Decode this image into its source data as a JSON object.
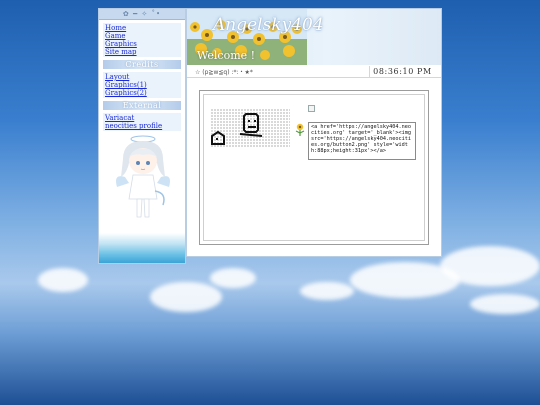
{
  "sidebar": {
    "top_label": "✿ ━ ✧ ˚•",
    "nav_links": [
      "Home",
      "Game",
      "Graphics",
      "Site map"
    ],
    "credits_heading": "Credits",
    "credit_links": [
      "Layout",
      "Graphics(1)",
      "Graphics(2)"
    ],
    "external_heading": "External",
    "external_links": [
      "Variacat",
      "neocities profile"
    ]
  },
  "banner": {
    "title": "Angelsky404",
    "welcome": "Welcome !"
  },
  "infobar": {
    "kaomoji": "☆ (p≧w≦q) :*:・★*",
    "clock": "08:36:10 PM"
  },
  "content": {
    "button_code": "<a href='https://angelsky404.neocities.org' target='_blank'><img src='https://angelsky404.neocities.org/button2.png' style='width:88px;height:31px'></a>"
  },
  "colors": {
    "link": "#1a2bd6",
    "sidebar_heading": "#b4ccea",
    "banner_sky": "#cfe4f6",
    "desktop_sky": "#3a7fcf"
  }
}
